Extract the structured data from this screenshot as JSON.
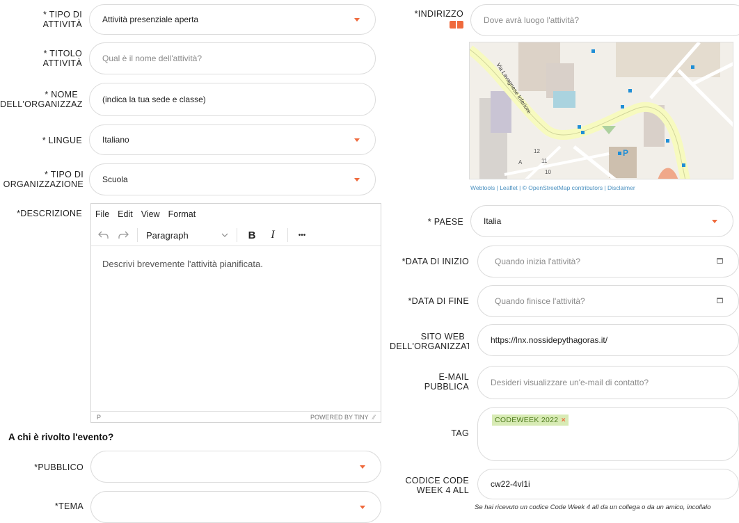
{
  "left": {
    "tipo_attivita": {
      "label_1": "* TIPO DI",
      "label_2": "ATTIVITÀ",
      "value": "Attività presenziale aperta"
    },
    "titolo_attivita": {
      "label_1": "* TITOLO",
      "label_2": "ATTIVITÀ",
      "placeholder": "Qual è il nome dell'attività?"
    },
    "nome_organizzazione": {
      "label_1": "* NOME",
      "label_2": "DELL'ORGANIZZAZIONE",
      "value": "(indica la tua sede e classe)"
    },
    "lingue": {
      "label": "* LINGUE",
      "value": "Italiano"
    },
    "tipo_organizzazione": {
      "label_1": "* TIPO DI",
      "label_2": "ORGANIZZAZIONE",
      "value": "Scuola"
    },
    "descrizione": {
      "label": "*DESCRIZIONE"
    },
    "section_heading": "A chi è rivolto l'evento?",
    "pubblico": {
      "label": "*PUBBLICO",
      "value": ""
    },
    "tema": {
      "label": "*TEMA",
      "value": ""
    }
  },
  "editor": {
    "menu": [
      "File",
      "Edit",
      "View",
      "Format"
    ],
    "undo_icon": "undo-icon",
    "redo_icon": "redo-icon",
    "block_format": "Paragraph",
    "bold": "B",
    "italic": "I",
    "more": "•••",
    "placeholder": "Descrivi brevemente l'attività pianificata.",
    "status_path": "P",
    "powered_by": "POWERED BY TINY"
  },
  "right": {
    "indirizzo": {
      "label": "*INDIRIZZO",
      "placeholder": "Dove avrà luogo l'attività?",
      "icon": "map-book-icon"
    },
    "map": {
      "road_label": "Via Lavagnese Inferiore",
      "numbers": [
        "12",
        "11",
        "10",
        "A"
      ],
      "parking": "P"
    },
    "attribution": "Webtools | Leaflet | © OpenStreetMap contributors | Disclaimer",
    "paese": {
      "label": "* PAESE",
      "value": "Italia"
    },
    "data_inizio": {
      "label": "*DATA DI INIZIO",
      "placeholder": "Quando inizia l'attività?"
    },
    "data_fine": {
      "label": "*DATA DI FINE",
      "placeholder": "Quando finisce l'attività?"
    },
    "sito_web": {
      "label_1": "SITO WEB",
      "label_2": "DELL'ORGANIZZATORE",
      "value": "https://lnx.nossidepythagoras.it/"
    },
    "email": {
      "label_1": "E-MAIL",
      "label_2": "PUBBLICA",
      "placeholder": "Desideri visualizzare un'e-mail di contatto?"
    },
    "tag": {
      "label": "TAG",
      "chip": "CODEWEEK 2022",
      "chip_remove": "×"
    },
    "codice": {
      "label_1": "CODICE CODE",
      "label_2": "WEEK 4 ALL",
      "value": "cw22-4vl1i"
    },
    "hint": "Se hai ricevuto un codice Code Week 4 all da un collega o da un amico, incollalo"
  },
  "colors": {
    "accent": "#ef6a3d",
    "tag_bg": "#d8ebb5",
    "tag_text": "#4d7a1b",
    "link": "#4a90c0"
  }
}
